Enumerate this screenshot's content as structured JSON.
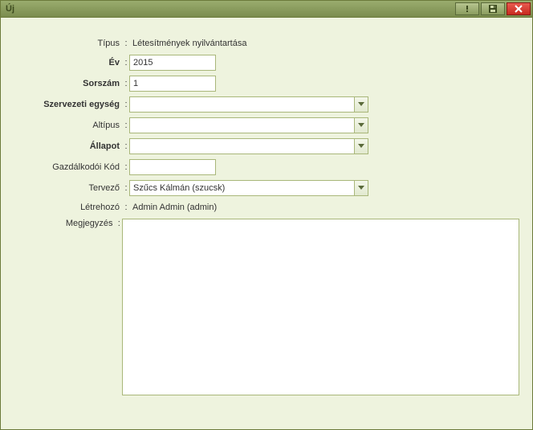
{
  "window": {
    "title": "Új"
  },
  "labels": {
    "tipus": "Típus",
    "ev": "Év",
    "sorszam": "Sorszám",
    "szervezeti_egyseg": "Szervezeti egység",
    "altipus": "Altípus",
    "allapot": "Állapot",
    "gazdalkodoi_kod": "Gazdálkodói Kód",
    "tervezo": "Tervező",
    "letrehozo": "Létrehozó",
    "megjegyzes": "Megjegyzés"
  },
  "values": {
    "tipus": "Létesítmények nyilvántartása",
    "ev": "2015",
    "sorszam": "1",
    "szervezeti_egyseg": "",
    "altipus": "",
    "allapot": "",
    "gazdalkodoi_kod": "",
    "tervezo": "Szűcs Kálmán (szucsk)",
    "letrehozo": "Admin Admin (admin)",
    "megjegyzes": ""
  },
  "colon": ":"
}
